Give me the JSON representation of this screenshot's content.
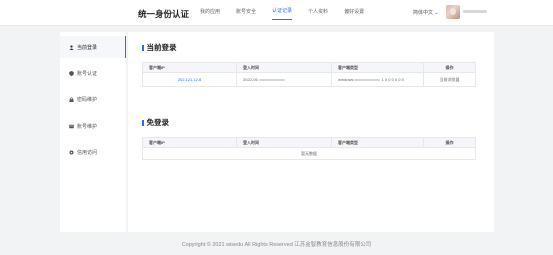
{
  "header": {
    "title": "统一身份认证",
    "nav": [
      "我的应用",
      "账号安全",
      "认证记录",
      "个人资料",
      "偏好设置"
    ],
    "active_nav": "认证记录",
    "language": "简体中文"
  },
  "sidebar": {
    "items": [
      {
        "label": "当前登录",
        "icon": "user-icon",
        "active": true
      },
      {
        "label": "账号认证",
        "icon": "shield-icon",
        "active": false
      },
      {
        "label": "密码维护",
        "icon": "lock-icon",
        "active": false
      },
      {
        "label": "账号维护",
        "icon": "account-icon",
        "active": false
      },
      {
        "label": "信用访问",
        "icon": "gear-icon",
        "active": false
      }
    ]
  },
  "current_login": {
    "title": "当前登录",
    "columns": [
      "客户端IP",
      "登入时间",
      "客户端类型",
      "操作"
    ],
    "rows": [
      {
        "ip": "202.121.12.8",
        "time": "2022-06",
        "client": "windows",
        "client_suffix": "1 0 0 0 0 0 0",
        "action": "当前浏览器"
      }
    ]
  },
  "free_login": {
    "title": "免登录",
    "columns": [
      "客户端IP",
      "登入时间",
      "客户端类型",
      "操作"
    ],
    "empty_text": "暂无数据"
  },
  "footer": {
    "copyright": "Copyright © 2021 wisedu All Rights Reserved 江苏金智教育信息股份有限公司"
  }
}
